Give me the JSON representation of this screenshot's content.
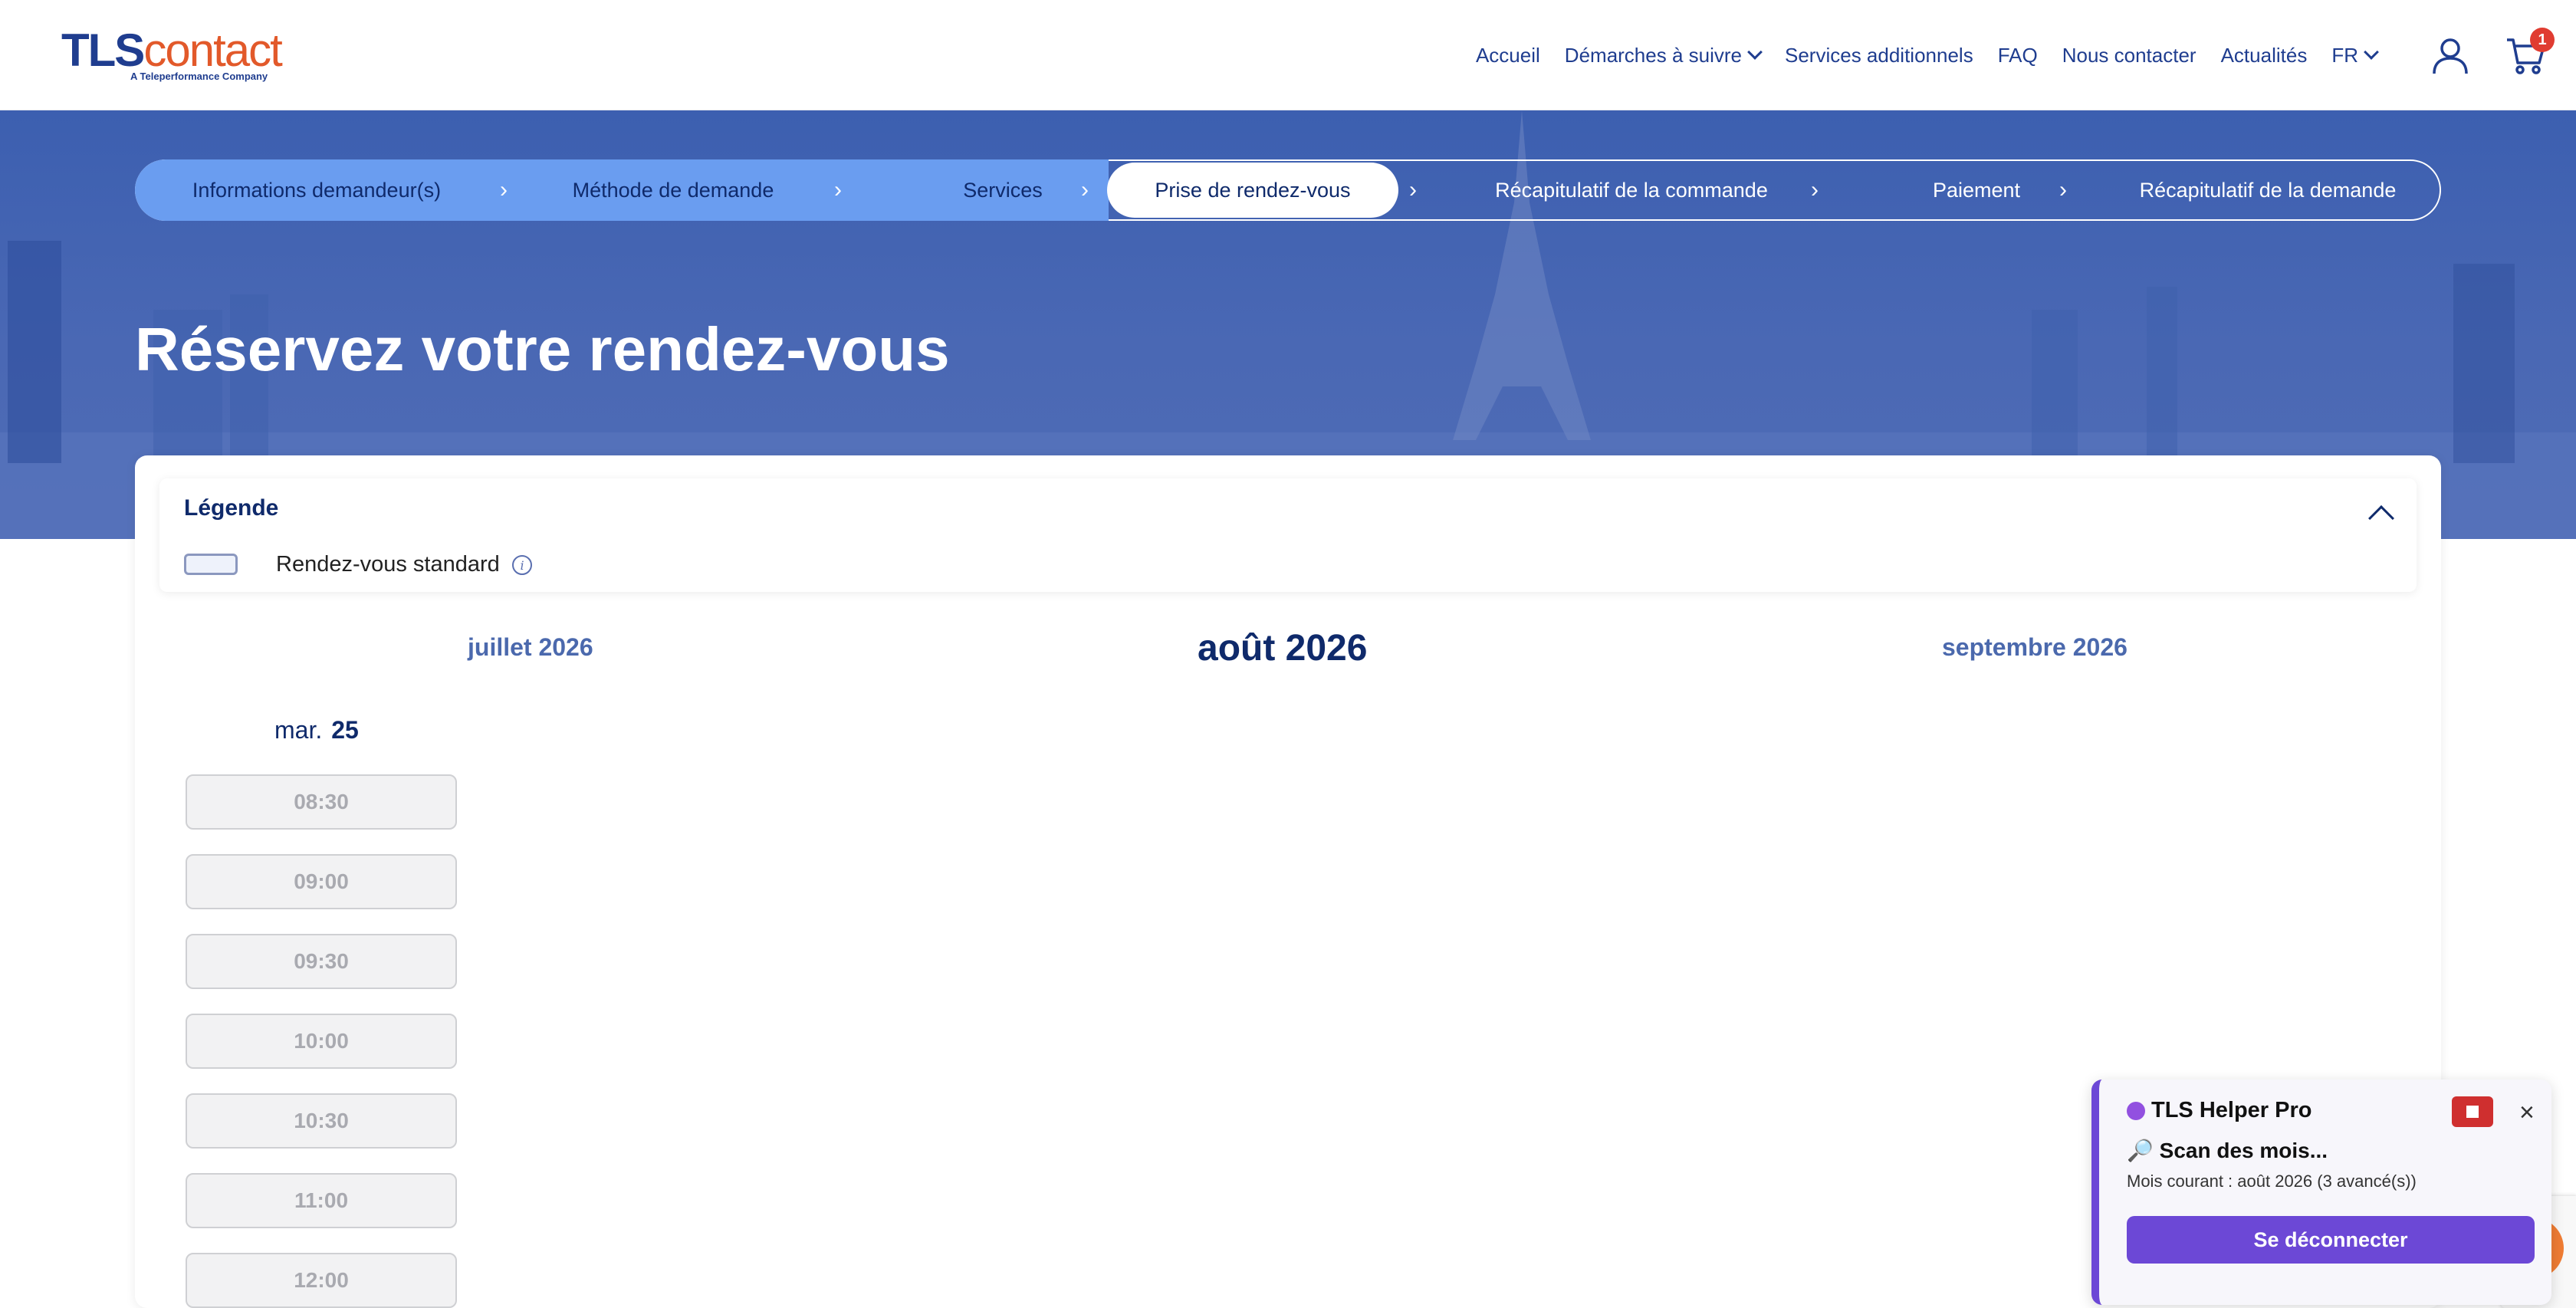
{
  "header": {
    "logo_brand": "TLS",
    "logo_brand_suffix": "contact",
    "logo_tagline": "A Teleperformance Company",
    "nav": [
      "Accueil",
      "Démarches à suivre",
      "Services additionnels",
      "FAQ",
      "Nous contacter",
      "Actualités"
    ],
    "language": "FR",
    "cart_count": "1",
    "icons": {
      "user": "user-icon",
      "cart": "cart-icon"
    }
  },
  "stepper": {
    "steps": [
      "Informations demandeur(s)",
      "Méthode de demande",
      "Services",
      "Prise de rendez-vous",
      "Récapitulatif de la commande",
      "Paiement",
      "Récapitulatif de la demande"
    ],
    "active_index": 3,
    "separator": "›"
  },
  "hero": {
    "title": "Réservez votre rendez-vous"
  },
  "legend": {
    "title": "Légende",
    "items": [
      {
        "label": "Rendez-vous standard"
      }
    ],
    "info_glyph": "i"
  },
  "calendar": {
    "prev_month": "juillet 2026",
    "current_month": "août 2026",
    "next_month": "septembre 2026",
    "day_name": "mar.",
    "day_number": "25",
    "slots": [
      "08:30",
      "09:00",
      "09:30",
      "10:00",
      "10:30",
      "11:00",
      "12:00"
    ]
  },
  "helper": {
    "title": "TLS Helper Pro",
    "status": "🔎 Scan des mois...",
    "detail": "Mois courant : août 2026 (3 avancé(s))",
    "button": "Se déconnecter",
    "close_glyph": "×"
  },
  "colors": {
    "brand_blue": "#1f3d8f",
    "brand_orange": "#e2592a",
    "step_done": "#6a9df0",
    "hero": "#4a68b4",
    "helper_accent": "#6c48d6"
  }
}
